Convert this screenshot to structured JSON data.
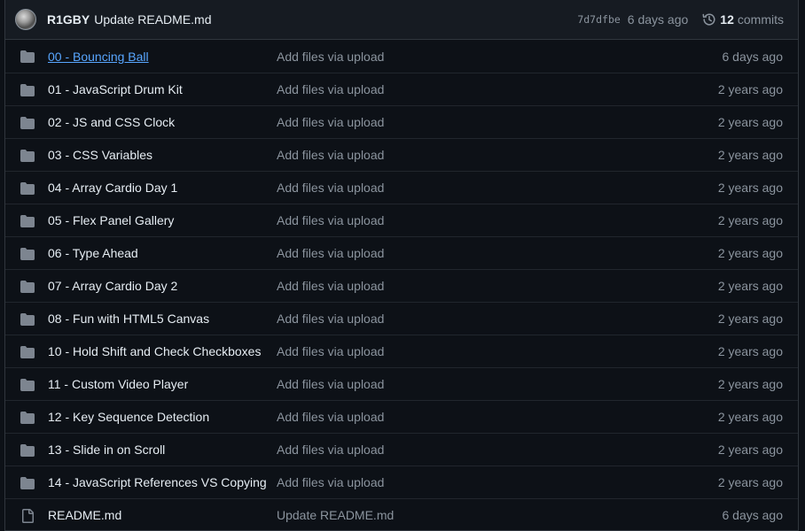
{
  "commit": {
    "author": "R1GBY",
    "message": "Update README.md",
    "sha": "7d7dfbe",
    "time": "6 days ago",
    "commit_count": "12",
    "commits_label": "commits"
  },
  "files": [
    {
      "type": "dir",
      "name": "00 - Bouncing Ball",
      "message": "Add files via upload",
      "age": "6 days ago",
      "hovered": true
    },
    {
      "type": "dir",
      "name": "01 - JavaScript Drum Kit",
      "message": "Add files via upload",
      "age": "2 years ago"
    },
    {
      "type": "dir",
      "name": "02 - JS and CSS Clock",
      "message": "Add files via upload",
      "age": "2 years ago"
    },
    {
      "type": "dir",
      "name": "03 - CSS Variables",
      "message": "Add files via upload",
      "age": "2 years ago"
    },
    {
      "type": "dir",
      "name": "04 - Array Cardio Day 1",
      "message": "Add files via upload",
      "age": "2 years ago"
    },
    {
      "type": "dir",
      "name": "05 - Flex Panel Gallery",
      "message": "Add files via upload",
      "age": "2 years ago"
    },
    {
      "type": "dir",
      "name": "06 - Type Ahead",
      "message": "Add files via upload",
      "age": "2 years ago"
    },
    {
      "type": "dir",
      "name": "07 - Array Cardio Day 2",
      "message": "Add files via upload",
      "age": "2 years ago"
    },
    {
      "type": "dir",
      "name": "08 - Fun with HTML5 Canvas",
      "message": "Add files via upload",
      "age": "2 years ago"
    },
    {
      "type": "dir",
      "name": "10 - Hold Shift and Check Checkboxes",
      "message": "Add files via upload",
      "age": "2 years ago"
    },
    {
      "type": "dir",
      "name": "11 - Custom Video Player",
      "message": "Add files via upload",
      "age": "2 years ago"
    },
    {
      "type": "dir",
      "name": "12 - Key Sequence Detection",
      "message": "Add files via upload",
      "age": "2 years ago"
    },
    {
      "type": "dir",
      "name": "13 - Slide in on Scroll",
      "message": "Add files via upload",
      "age": "2 years ago"
    },
    {
      "type": "dir",
      "name": "14 - JavaScript References VS Copying",
      "message": "Add files via upload",
      "age": "2 years ago"
    },
    {
      "type": "file",
      "name": "README.md",
      "message": "Update README.md",
      "age": "6 days ago"
    }
  ],
  "icons": {
    "dir": "folder-icon",
    "file": "file-icon",
    "history": "history-icon"
  },
  "colors": {
    "background": "#0d1117",
    "header_background": "#161b22",
    "folder": "#7d8590",
    "link": "#58a6ff",
    "muted_text": "#8b949e"
  }
}
